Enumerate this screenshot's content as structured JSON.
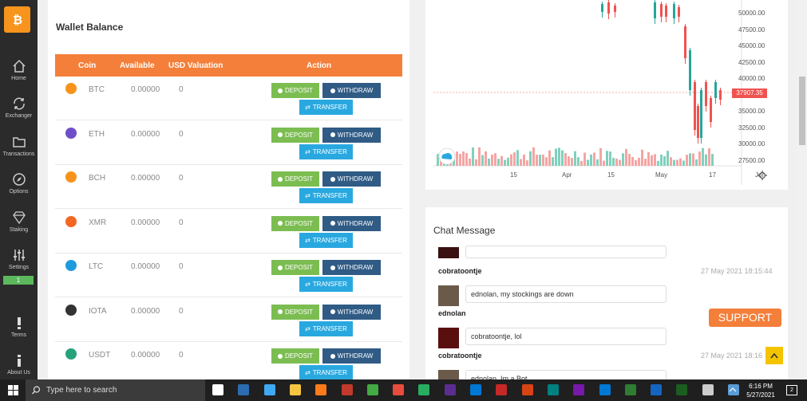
{
  "sidebar": {
    "items": [
      {
        "label": "Home"
      },
      {
        "label": "Exchanger"
      },
      {
        "label": "Transactions"
      },
      {
        "label": "Options"
      },
      {
        "label": "Staking"
      },
      {
        "label": "Settings"
      },
      {
        "label": "Terms"
      },
      {
        "label": "About Us"
      }
    ],
    "settings_badge": "1"
  },
  "wallet": {
    "title": "Wallet Balance",
    "columns": [
      "Coin",
      "Available",
      "USD Valuation",
      "Action"
    ],
    "rows": [
      {
        "symbol": "BTC",
        "available": "0.00000",
        "usd": "0",
        "color": "#f7931a",
        "icon": "bitcoin-icon"
      },
      {
        "symbol": "ETH",
        "available": "0.00000",
        "usd": "0",
        "color": "#6f4fc9",
        "icon": "ethereum-icon"
      },
      {
        "symbol": "BCH",
        "available": "0.00000",
        "usd": "0",
        "color": "#f7931a",
        "icon": "bitcoin-cash-icon"
      },
      {
        "symbol": "XMR",
        "available": "0.00000",
        "usd": "0",
        "color": "#f26822",
        "icon": "monero-icon"
      },
      {
        "symbol": "LTC",
        "available": "0.00000",
        "usd": "0",
        "color": "#1e9bde",
        "icon": "litecoin-icon"
      },
      {
        "symbol": "IOTA",
        "available": "0.00000",
        "usd": "0",
        "color": "#333333",
        "icon": "iota-icon"
      },
      {
        "symbol": "USDT",
        "available": "0.00000",
        "usd": "0",
        "color": "#26a17b",
        "icon": "tether-icon"
      }
    ],
    "deposit_label": "DEPOSIT",
    "withdraw_label": "WITHDRAW",
    "transfer_label": "TRANSFER"
  },
  "chart": {
    "price_ticks": [
      "50000.00",
      "47500.00",
      "45000.00",
      "42500.00",
      "40000.00",
      "35000.00",
      "32500.00",
      "30000.00",
      "27500.00"
    ],
    "current_price": "37907.35",
    "x_ticks": [
      "15",
      "Apr",
      "15",
      "May",
      "17",
      "Jun"
    ]
  },
  "chat": {
    "title": "Chat Message",
    "messages": [
      {
        "text": "",
        "user": "cobratoontje",
        "time": "27 May 2021 18:15:44"
      },
      {
        "text": "ednolan, my stockings are down",
        "user": "ednolan",
        "time": ""
      },
      {
        "text": "cobratoontje, lol",
        "user": "cobratoontje",
        "time": "27 May 2021 18:16"
      },
      {
        "text": "ednolan, Im a Bot",
        "user": "",
        "time": ""
      }
    ]
  },
  "support_label": "SUPPORT",
  "taskbar": {
    "search_placeholder": "Type here to search",
    "time": "6:16 PM",
    "date": "5/27/2021",
    "notification_count": "2"
  }
}
